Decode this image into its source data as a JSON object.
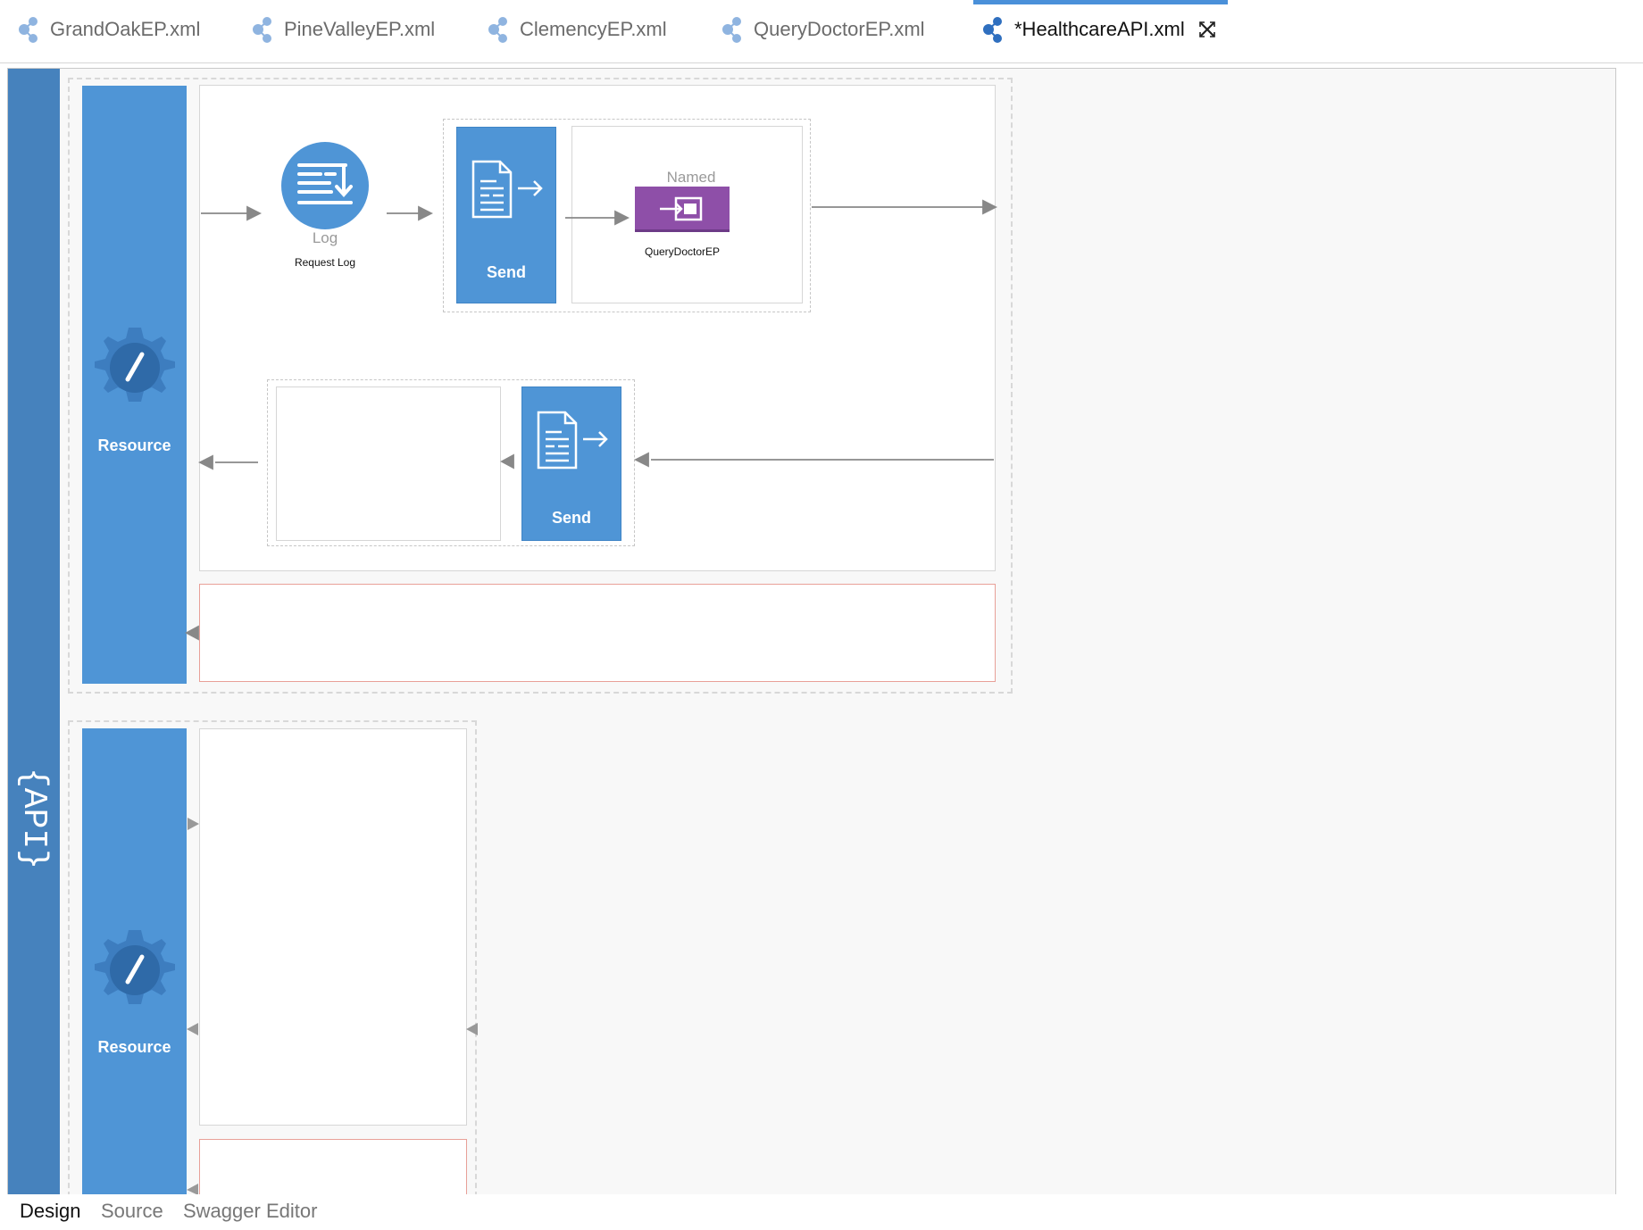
{
  "tabs": [
    {
      "label": "GrandOakEP.xml",
      "icon": "endpoint-icon"
    },
    {
      "label": "PineValleyEP.xml",
      "icon": "endpoint-icon"
    },
    {
      "label": "ClemencyEP.xml",
      "icon": "endpoint-icon"
    },
    {
      "label": "QueryDoctorEP.xml",
      "icon": "endpoint-icon"
    },
    {
      "label": "*HealthcareAPI.xml",
      "icon": "api-icon",
      "active": true
    }
  ],
  "api_bar": {
    "label": "{API}"
  },
  "resources": [
    {
      "label": "Resource",
      "in_sequence": {
        "log": {
          "type_label": "Log",
          "name": "Request Log"
        },
        "send": {
          "label": "Send"
        },
        "endpoint": {
          "type_label": "Named",
          "name": "QueryDoctorEP"
        }
      },
      "out_sequence": {
        "send": {
          "label": "Send"
        }
      }
    },
    {
      "label": "Resource"
    }
  ],
  "bottom_tabs": [
    {
      "label": "Design",
      "active": true
    },
    {
      "label": "Source"
    },
    {
      "label": "Swagger Editor"
    }
  ],
  "colors": {
    "api_bar": "#4682bd",
    "resource_blue": "#4f95d6",
    "endpoint_purple": "#8e4fa8",
    "active_tab_accent": "#4a90d9",
    "fault_border": "#e8a098"
  }
}
